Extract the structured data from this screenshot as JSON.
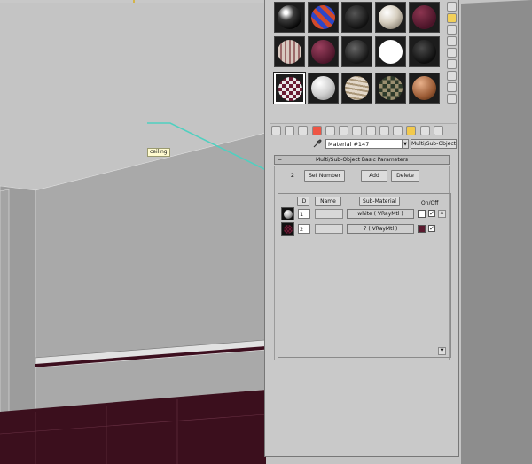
{
  "viewport": {
    "tag_label": "ceiling"
  },
  "material_editor": {
    "material_name": "Material #147",
    "material_type": "Multi/Sub-Object",
    "rollout_title": "Multi/Sub-Object Basic Parameters",
    "rollout_toggle": "−",
    "num_materials": "2",
    "set_number_label": "Set Number",
    "add_label": "Add",
    "delete_label": "Delete",
    "columns": {
      "id": "ID",
      "name": "Name",
      "sub_material": "Sub-Material",
      "on_off": "On/Off"
    },
    "rows": [
      {
        "id": "1",
        "name": "",
        "sub_material": "white  ( VRayMtl )",
        "swatch": "#ffffff",
        "checked": "✓"
      },
      {
        "id": "2",
        "name": "",
        "sub_material": "7  ( VRayMtl )",
        "swatch": "#5a1a2e",
        "checked": "✓"
      }
    ],
    "row_side_button": "A",
    "scroll_down": "▼",
    "dropdown_arrow": "▼"
  },
  "colors": {
    "wall": "#a9a9a9",
    "ceiling": "#c2c2c2",
    "floor": "#3b0f1d",
    "link_line": "#4fd0c0",
    "active_tool": "#f2c94c"
  }
}
